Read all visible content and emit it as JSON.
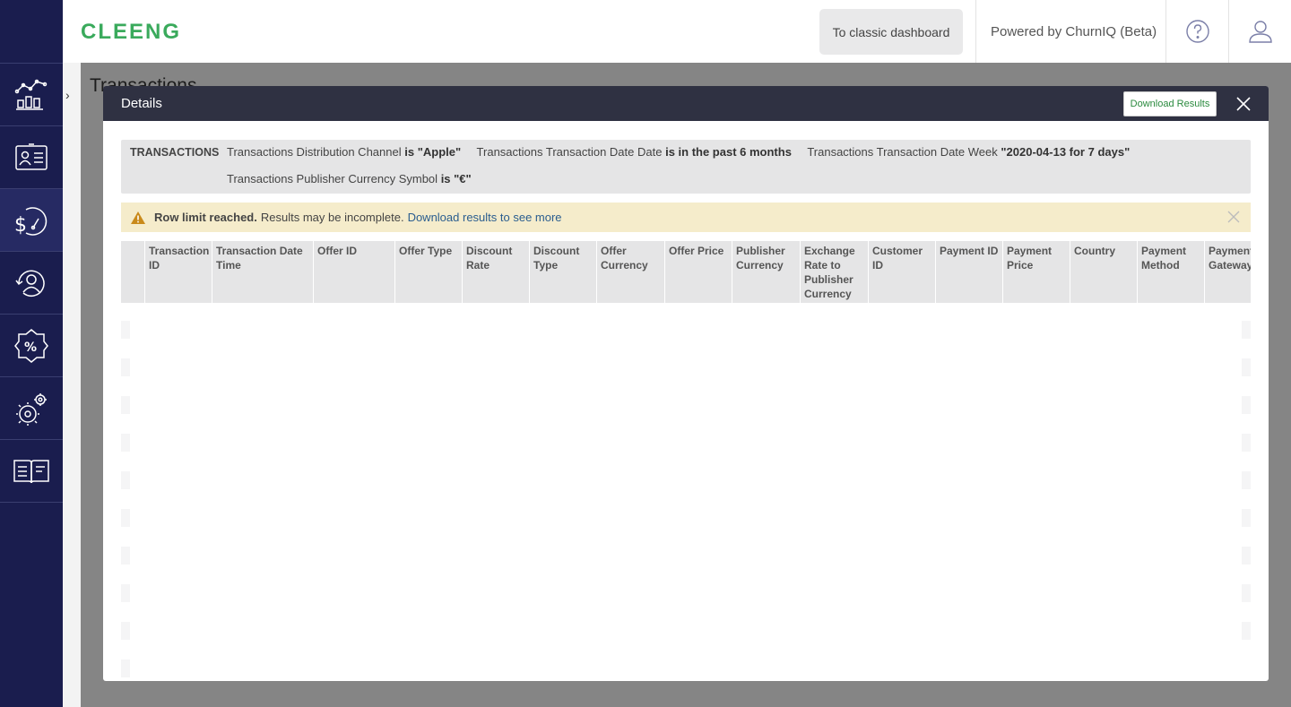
{
  "app": {
    "logo_text": "CLEENG"
  },
  "topbar": {
    "classic_label": "To classic dashboard",
    "powered_label": "Powered by ChurnIQ (Beta)"
  },
  "sidebar": {
    "items": [
      {
        "icon": "analytics-chart-icon"
      },
      {
        "icon": "subscriber-card-icon"
      },
      {
        "icon": "revenue-gauge-icon"
      },
      {
        "icon": "churn-user-icon"
      },
      {
        "icon": "discount-badge-icon"
      },
      {
        "icon": "settings-gears-icon"
      },
      {
        "icon": "open-book-icon"
      }
    ]
  },
  "background_page": {
    "title": "Transactions"
  },
  "modal": {
    "title": "Details",
    "download_label": "Download Results",
    "filters": {
      "heading": "TRANSACTIONS",
      "items": [
        {
          "field": "Transactions Distribution Channel",
          "value": "is \"Apple\""
        },
        {
          "field": "Transactions Transaction Date Date",
          "value": "is in the past 6 months"
        },
        {
          "field": "Transactions Transaction Date Week",
          "value": "\"2020-04-13 for 7 days\""
        },
        {
          "field": "Transactions Publisher Currency Symbol",
          "value": "is \"€\""
        }
      ]
    },
    "warning": {
      "bold": "Row limit reached.",
      "text": "Results may be incomplete.",
      "link": "Download results to see more"
    },
    "columns": [
      "Transaction ID",
      "Transaction Date Time",
      "Offer ID",
      "Offer Type",
      "Discount Rate",
      "Discount Type",
      "Offer Currency",
      "Offer Price",
      "Publisher Currency",
      "Exchange Rate to Publisher Currency",
      "Customer ID",
      "Payment ID",
      "Payment Price",
      "Country",
      "Payment Method",
      "Payment Gateway"
    ]
  },
  "colors": {
    "sidebar": "#1a1d4e",
    "modal_header": "#2f3142",
    "brand_green": "#3aaa5c",
    "warning_bg": "#f5eccb"
  }
}
